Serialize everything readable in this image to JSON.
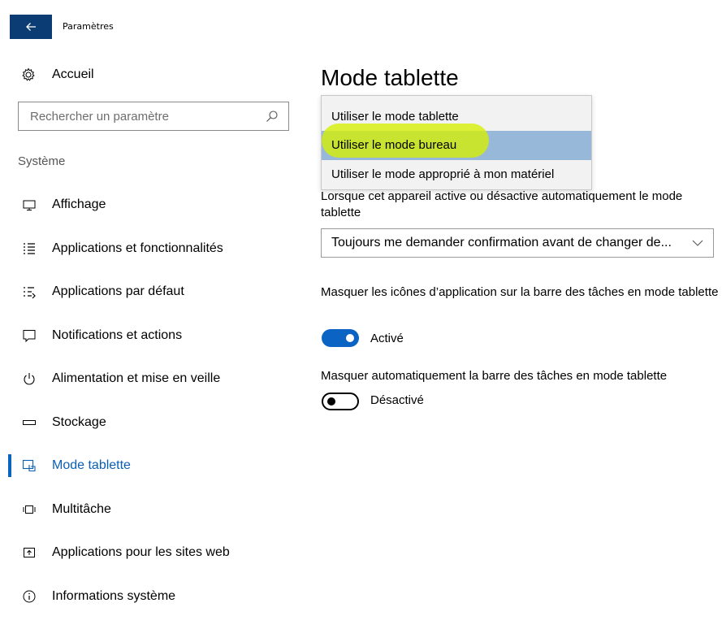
{
  "window": {
    "title": "Paramètres"
  },
  "sidebar": {
    "home_label": "Accueil",
    "search_placeholder": "Rechercher un paramètre",
    "section": "Système",
    "items": [
      {
        "label": "Affichage",
        "icon": "display-icon"
      },
      {
        "label": "Applications et fonctionnalités",
        "icon": "apps-list-icon"
      },
      {
        "label": "Applications par défaut",
        "icon": "default-apps-icon"
      },
      {
        "label": "Notifications et actions",
        "icon": "notification-icon"
      },
      {
        "label": "Alimentation et mise en veille",
        "icon": "power-icon"
      },
      {
        "label": "Stockage",
        "icon": "storage-icon"
      },
      {
        "label": "Mode tablette",
        "icon": "tablet-mode-icon",
        "active": true
      },
      {
        "label": "Multitâche",
        "icon": "multitask-icon"
      },
      {
        "label": "Applications pour les sites web",
        "icon": "web-apps-icon"
      },
      {
        "label": "Informations système",
        "icon": "info-icon"
      }
    ]
  },
  "main": {
    "title": "Mode tablette",
    "dropdown_options": [
      "Utiliser le mode tablette",
      "Utiliser le mode bureau",
      "Utiliser le mode approprié à mon matériel"
    ],
    "selected_option_index": 1,
    "setting_prompt_label": "Lorsque cet appareil active ou désactive automatiquement le mode tablette",
    "prompt_combo_value": "Toujours me demander confirmation avant de changer de...",
    "hide_icons_label": "Masquer les icônes d’application sur la barre des tâches en mode tablette",
    "hide_icons_state": "Activé",
    "hide_icons_on": true,
    "autohide_label": "Masquer automatiquement la barre des tâches en mode tablette",
    "autohide_state": "Désactivé",
    "autohide_on": false
  },
  "colors": {
    "accent": "#0b63c4",
    "titlebar_back": "#0b3c73",
    "selection": "#98b8d9",
    "marker_highlight": "#d6f000"
  }
}
